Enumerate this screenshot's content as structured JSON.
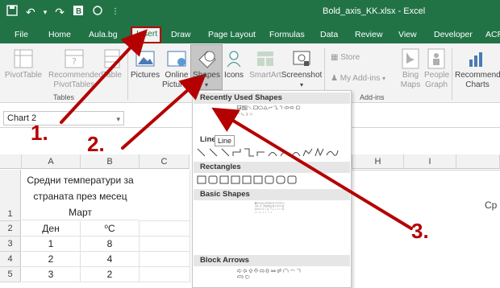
{
  "window": {
    "title": "Bold_axis_KK.xlsx  -  Excel"
  },
  "tabs": [
    "File",
    "Home",
    "Aula.bg",
    "Insert",
    "Draw",
    "Page Layout",
    "Formulas",
    "Data",
    "Review",
    "View",
    "Developer",
    "ACR"
  ],
  "ribbon": {
    "pivottable": "PivotTable",
    "recommended_pivot": [
      "Recommended",
      "PivotTables"
    ],
    "table": "Table",
    "tables_group": "Tables",
    "pictures": "Pictures",
    "online_pictures": [
      "Online",
      "Pictures"
    ],
    "shapes": "Shapes",
    "icons": "Icons",
    "smartart": "SmartArt",
    "screenshot": "Screenshot",
    "store": "Store",
    "my_addins": "My Add-ins",
    "addins_group": "Add-ins",
    "bing_maps": [
      "Bing",
      "Maps"
    ],
    "people_graph": [
      "People",
      "Graph"
    ],
    "recommended_charts": [
      "Recommende",
      "Charts"
    ]
  },
  "namebox": {
    "value": "Chart 2"
  },
  "grid": {
    "columns": [
      "A",
      "B",
      "C",
      "H",
      "I"
    ],
    "rows": [
      "1",
      "2",
      "3",
      "4",
      "5"
    ],
    "header_text": "Средни температури за страната през месец Март",
    "col_a_header": "Ден",
    "col_b_header": "⁰C",
    "data": [
      [
        "1",
        "8"
      ],
      [
        "2",
        "4"
      ],
      [
        "3",
        "2"
      ]
    ],
    "right_text": "Ср"
  },
  "shapes_menu": {
    "recently_used": "Recently Used Shapes",
    "lines": "Lines",
    "rectangles": "Rectangles",
    "basic_shapes": "Basic Shapes",
    "block_arrows": "Block Arrows",
    "tooltip": "Line"
  },
  "annotations": [
    "1.",
    "2.",
    "3."
  ],
  "colors": {
    "excel_green": "#217346",
    "arrow_red": "#b40000"
  }
}
